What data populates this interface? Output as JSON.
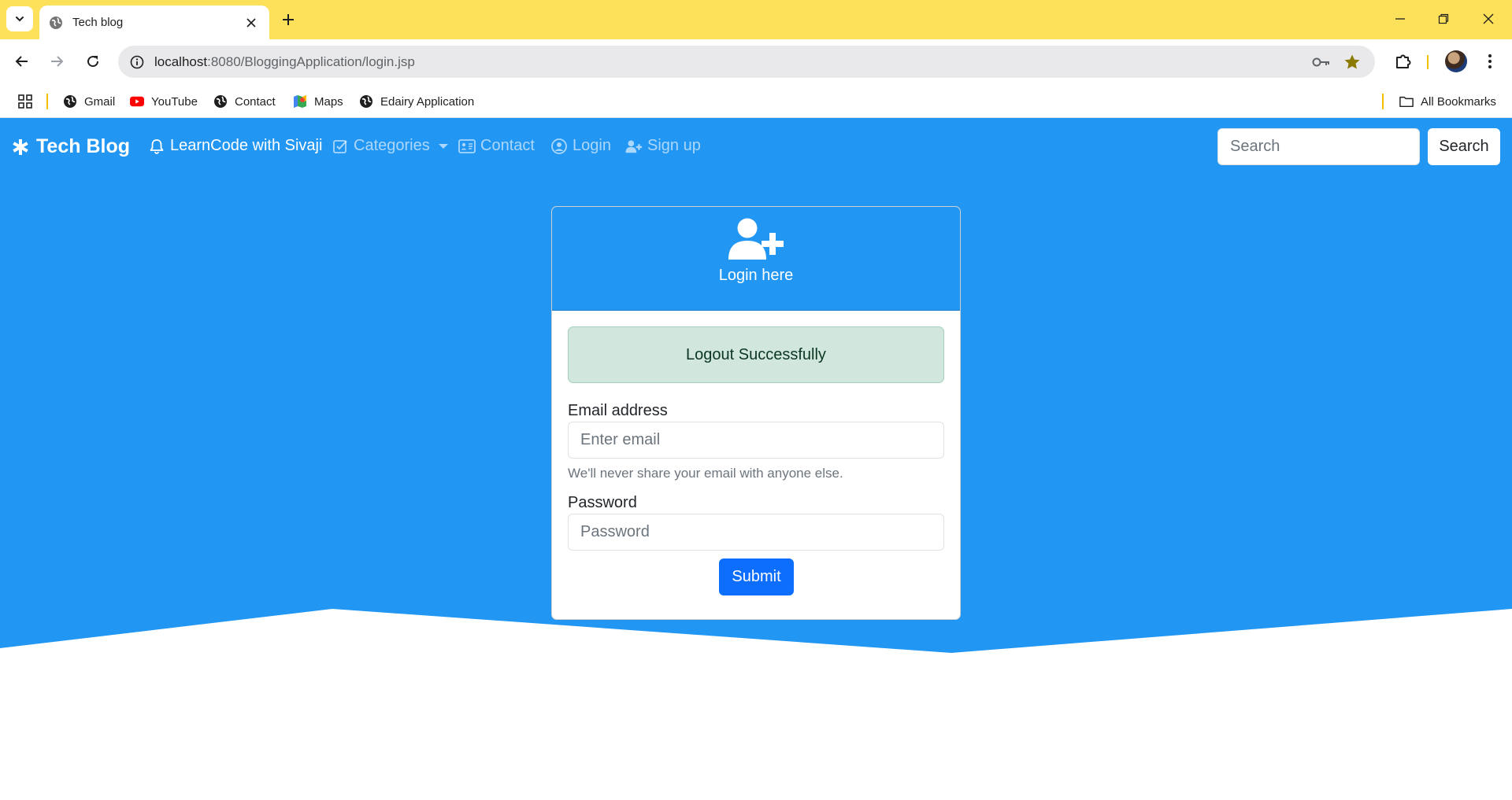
{
  "browser": {
    "tab_title": "Tech blog",
    "url_host": "localhost",
    "url_rest": ":8080/BloggingApplication/login.jsp",
    "bookmarks": [
      {
        "label": "Gmail",
        "icon": "globe-icon"
      },
      {
        "label": "YouTube",
        "icon": "youtube-icon"
      },
      {
        "label": "Contact",
        "icon": "globe-icon"
      },
      {
        "label": "Maps",
        "icon": "maps-icon"
      },
      {
        "label": "Edairy Application",
        "icon": "globe-icon"
      }
    ],
    "all_bookmarks": "All Bookmarks",
    "accent_color": "#fde15a"
  },
  "navbar": {
    "brand": "Tech Blog",
    "links": [
      {
        "label": "LearnCode with Sivaji",
        "icon": "bell-icon",
        "active": true
      },
      {
        "label": "Categories",
        "icon": "check-square-icon",
        "active": false
      },
      {
        "label": "Contact",
        "icon": "address-card-icon",
        "active": false
      },
      {
        "label": "Login",
        "icon": "user-circle-icon",
        "active": false
      },
      {
        "label": "Sign up",
        "icon": "user-plus-icon",
        "active": false
      }
    ],
    "search_placeholder": "Search",
    "search_button": "Search",
    "color": "#2196f3"
  },
  "login_card": {
    "title": "Login here",
    "alert": "Logout Successfully",
    "email_label": "Email address",
    "email_placeholder": "Enter email",
    "email_help": "We'll never share your email with anyone else.",
    "password_label": "Password",
    "password_placeholder": "Password",
    "submit": "Submit"
  }
}
